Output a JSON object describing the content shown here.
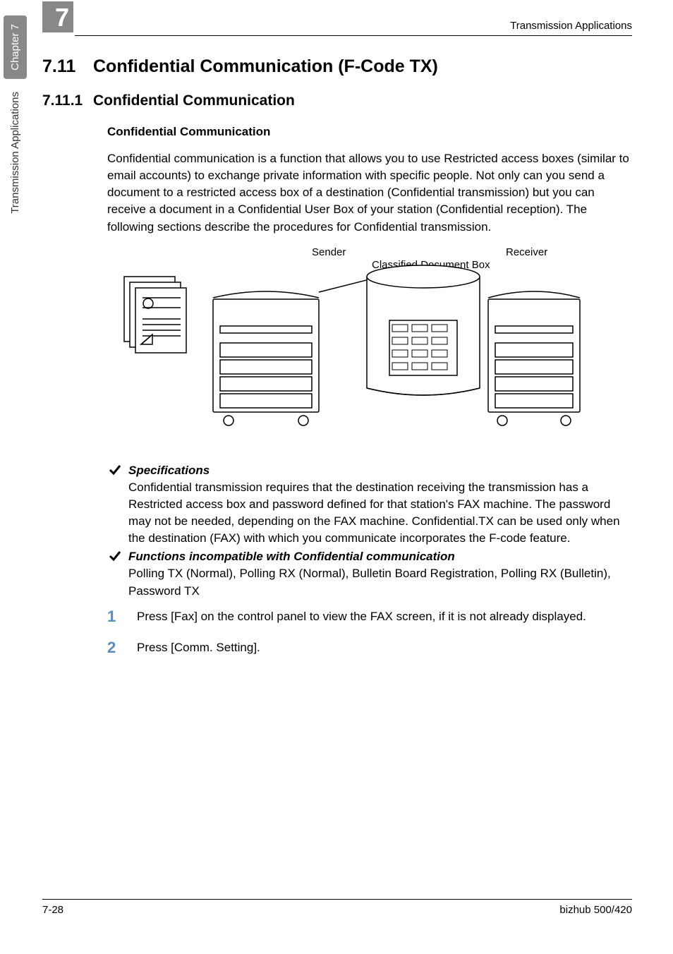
{
  "sideTab": {
    "chapter": "Chapter 7",
    "title": "Transmission Applications"
  },
  "sectionBadge": "7",
  "headerRight": "Transmission Applications",
  "h1": {
    "num": "7.11",
    "title": "Confidential Communication (F-Code TX)"
  },
  "h2": {
    "num": "7.11.1",
    "title": "Confidential Communication"
  },
  "h3": "Confidential Communication",
  "intro": "Confidential communication is a function that allows you to use Restricted access boxes (similar to email accounts) to exchange private information with specific people. Not only can you send a document to a restricted access box of a destination (Confidential transmission) but you can receive a document in a Confidential User Box of your station (Confidential reception). The following sections describe the procedures for Confidential transmission.",
  "diagramLabels": {
    "sender": "Sender",
    "receiver": "Receiver",
    "box": "Classified Document Box"
  },
  "checks": [
    {
      "title": "Specifications",
      "body": "Confidential transmission requires that the destination receiving the transmission has a Restricted access box and password defined for that station's FAX machine. The password may not be needed, depending on the FAX machine. Confidential.TX can be used only when the destination (FAX) with which you communicate incorporates the F-code feature."
    },
    {
      "title": "Functions incompatible with Confidential communication",
      "body": "Polling TX (Normal), Polling RX (Normal), Bulletin Board Registration, Polling RX (Bulletin), Password TX"
    }
  ],
  "steps": [
    {
      "num": "1",
      "text": "Press [Fax] on the control panel to view the FAX screen, if it is not already displayed."
    },
    {
      "num": "2",
      "text": "Press [Comm. Setting]."
    }
  ],
  "footer": {
    "left": "7-28",
    "right": "bizhub 500/420"
  }
}
